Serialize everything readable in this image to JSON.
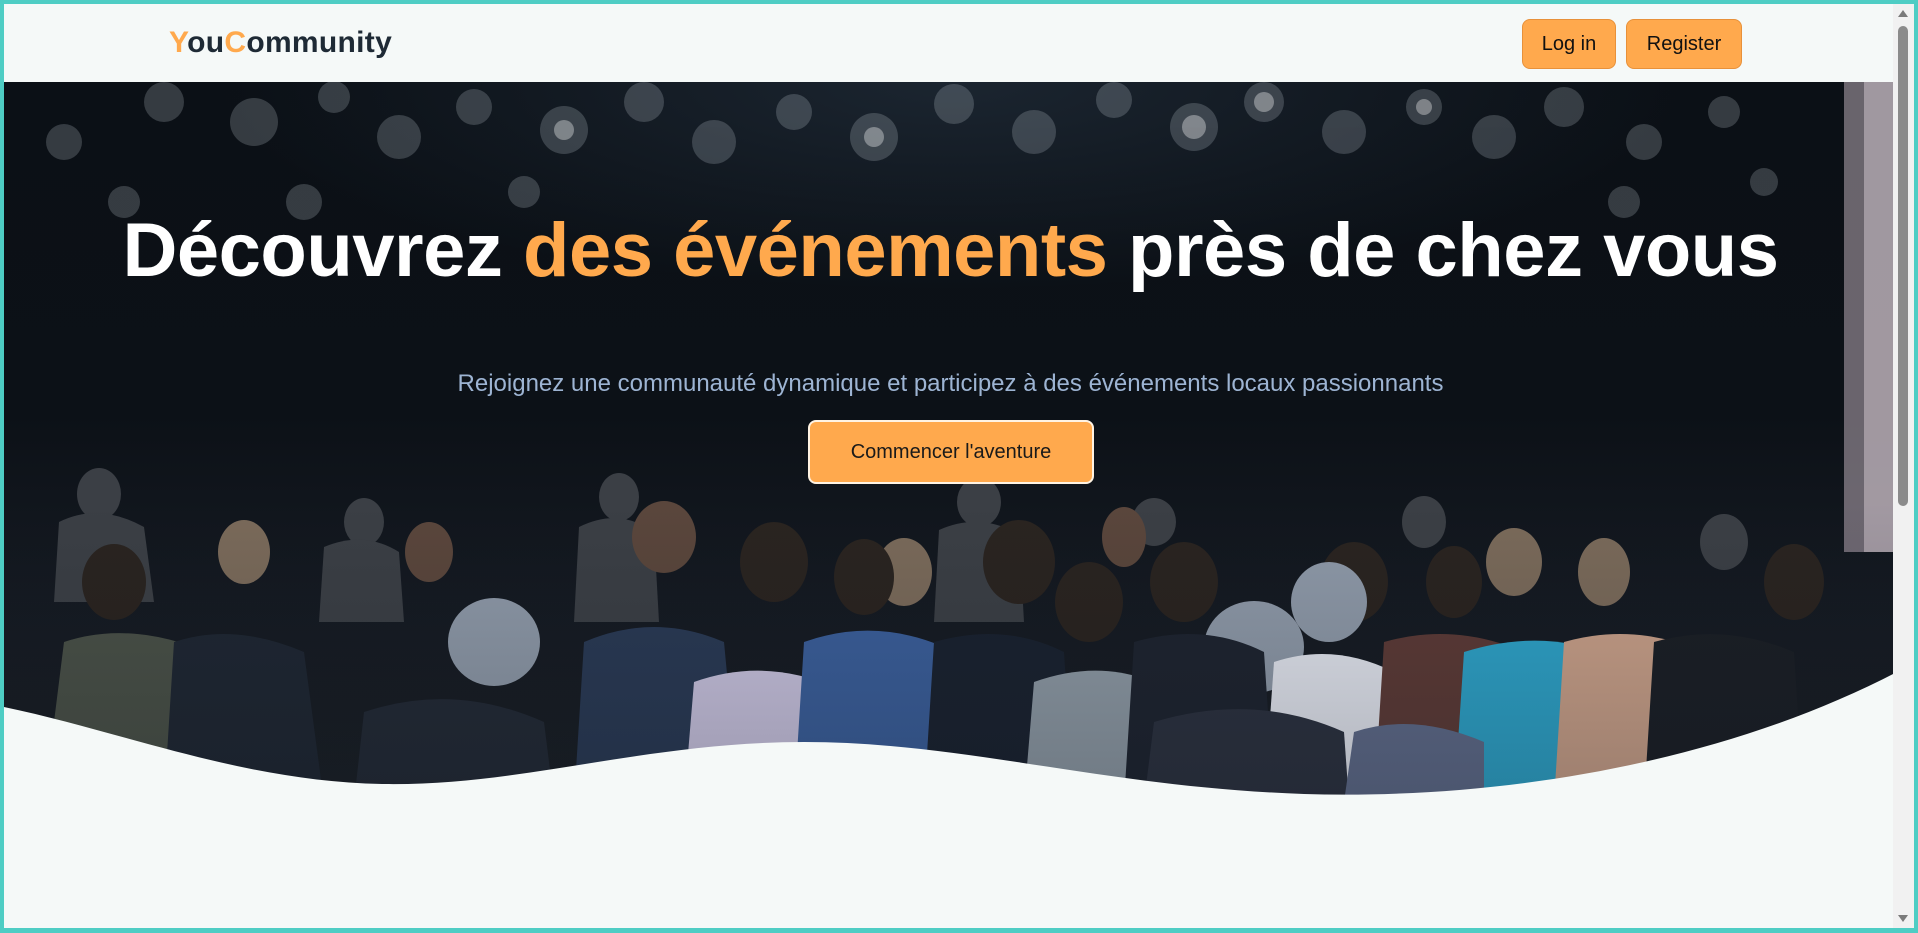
{
  "brand": {
    "part1_accent": "Y",
    "part1_rest": "ou",
    "part2_accent": "C",
    "part2_rest": "ommunity"
  },
  "nav": {
    "login_label": "Log in",
    "register_label": "Register"
  },
  "hero": {
    "title_before": "Découvrez ",
    "title_highlight": "des événements",
    "title_after": " près de chez vous",
    "subtitle": "Rejoignez une communauté dynamique et participez à des événements locaux passionnants",
    "cta_label": "Commencer l'aventure"
  },
  "colors": {
    "accent": "#ffa94d",
    "dark": "#0c1117",
    "background": "#f5f9f8",
    "subtitle": "#9db4d3"
  }
}
